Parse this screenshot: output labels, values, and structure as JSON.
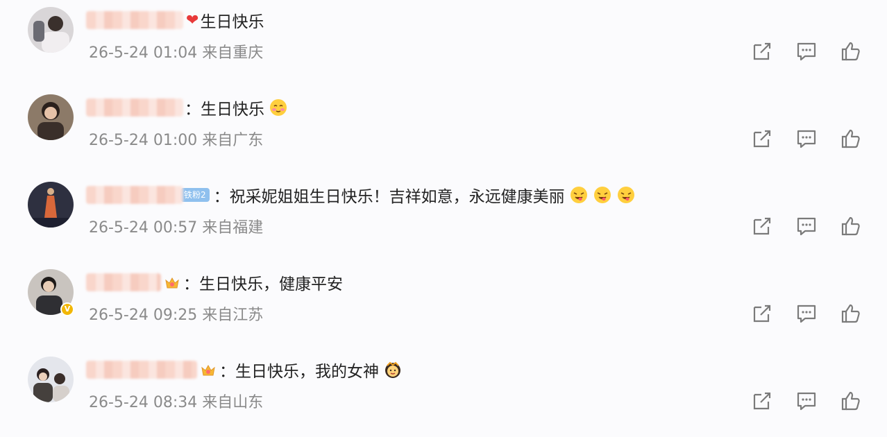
{
  "comments": [
    {
      "separator": "",
      "prefix_heart": "❤",
      "text": "生日快乐",
      "timestamp": "26-5-24 01:04",
      "location": "来自重庆",
      "avatar_color": "#6b6b73"
    },
    {
      "separator": "：",
      "text": "生日快乐",
      "timestamp": "26-5-24 01:00",
      "location": "来自广东",
      "avatar_color": "#5a4a40"
    },
    {
      "separator": "：",
      "fan_badge": "铁粉2",
      "text": "祝采妮姐姐生日快乐！吉祥如意，永远健康美丽",
      "timestamp": "26-5-24 00:57",
      "location": "来自福建",
      "avatar_color": "#3b3b4a"
    },
    {
      "separator": "：",
      "text": "生日快乐，健康平安",
      "timestamp": "26-5-24 09:25",
      "location": "来自江苏",
      "avatar_color": "#2f2f33",
      "verified": "V"
    },
    {
      "separator": "：",
      "text": "生日快乐，我的女神",
      "timestamp": "26-5-24 08:34",
      "location": "来自山东",
      "avatar_color": "#45403d"
    }
  ],
  "colors": {
    "meta_gray": "#8a8a8a",
    "icon_gray": "#7a7a7a",
    "heart_red": "#e83a3a",
    "fan_badge_blue": "#8fc0ee",
    "vip_gold": "#f2b705"
  },
  "icons": {
    "share": "share-icon",
    "comment": "comment-icon",
    "like": "thumbs-up-icon"
  }
}
